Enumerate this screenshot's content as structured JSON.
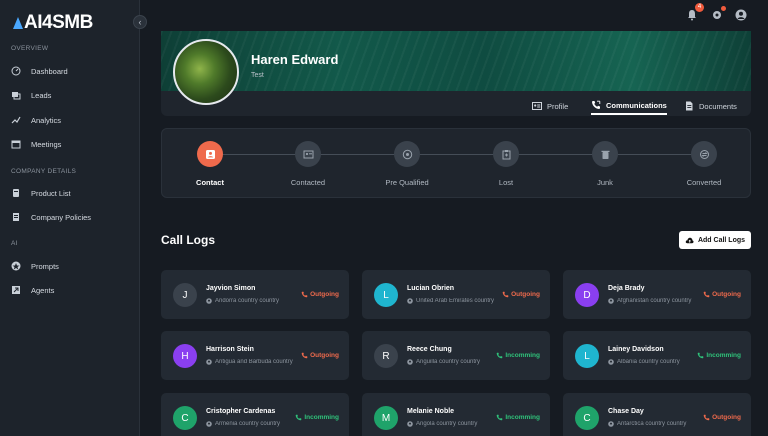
{
  "app": {
    "logo_text": "AI4SMB"
  },
  "sidebar": {
    "sections": [
      {
        "title": "OVERVIEW"
      },
      {
        "title": "COMPANY DETAILS"
      },
      {
        "title": "AI"
      }
    ],
    "items": [
      {
        "label": "Dashboard",
        "icon": "dashboard-icon"
      },
      {
        "label": "Leads",
        "icon": "leads-icon"
      },
      {
        "label": "Analytics",
        "icon": "analytics-icon"
      },
      {
        "label": "Meetings",
        "icon": "calendar-icon"
      },
      {
        "label": "Product List",
        "icon": "product-icon"
      },
      {
        "label": "Company Policies",
        "icon": "document-icon"
      },
      {
        "label": "Prompts",
        "icon": "star-icon"
      },
      {
        "label": "Agents",
        "icon": "agent-icon"
      }
    ]
  },
  "topbar": {
    "notification_count": "4"
  },
  "profile": {
    "name": "Haren Edward",
    "subtitle": "Test",
    "tabs": [
      {
        "label": "Profile"
      },
      {
        "label": "Communications"
      },
      {
        "label": "Documents"
      }
    ]
  },
  "stepper": {
    "steps": [
      {
        "label": "Contact"
      },
      {
        "label": "Contacted"
      },
      {
        "label": "Pre Qualified"
      },
      {
        "label": "Lost"
      },
      {
        "label": "Junk"
      },
      {
        "label": "Converted"
      }
    ]
  },
  "call_logs": {
    "title": "Call Logs",
    "add_label": "Add Call Logs",
    "colors": {
      "outgoing": "#ef6a4c",
      "incoming": "#2fc27a"
    },
    "cards": [
      {
        "initial": "J",
        "name": "Jayvion Simon",
        "location": "Andorra country country",
        "status": "Outgoing",
        "avatar_color": "#3a424c"
      },
      {
        "initial": "L",
        "name": "Lucian Obrien",
        "location": "United Arab Emirates country",
        "status": "Outgoing",
        "avatar_color": "#1fb5cf"
      },
      {
        "initial": "D",
        "name": "Deja Brady",
        "location": "Afghanistan country country",
        "status": "Outgoing",
        "avatar_color": "#8a3ff0"
      },
      {
        "initial": "H",
        "name": "Harrison Stein",
        "location": "Antigua and Barbuda country",
        "status": "Outgoing",
        "avatar_color": "#8a3ff0"
      },
      {
        "initial": "R",
        "name": "Reece Chung",
        "location": "Anguilla country country",
        "status": "Incomming",
        "avatar_color": "#3a424c"
      },
      {
        "initial": "L",
        "name": "Lainey Davidson",
        "location": "Albania country country",
        "status": "Incomming",
        "avatar_color": "#1fb5cf"
      },
      {
        "initial": "C",
        "name": "Cristopher Cardenas",
        "location": "Armenia country country",
        "status": "Incomming",
        "avatar_color": "#1fa36a"
      },
      {
        "initial": "M",
        "name": "Melanie Noble",
        "location": "Angola country country",
        "status": "Incomming",
        "avatar_color": "#1fa36a"
      },
      {
        "initial": "C",
        "name": "Chase Day",
        "location": "Antarctica country country",
        "status": "Outgoing",
        "avatar_color": "#1fa36a"
      }
    ]
  }
}
